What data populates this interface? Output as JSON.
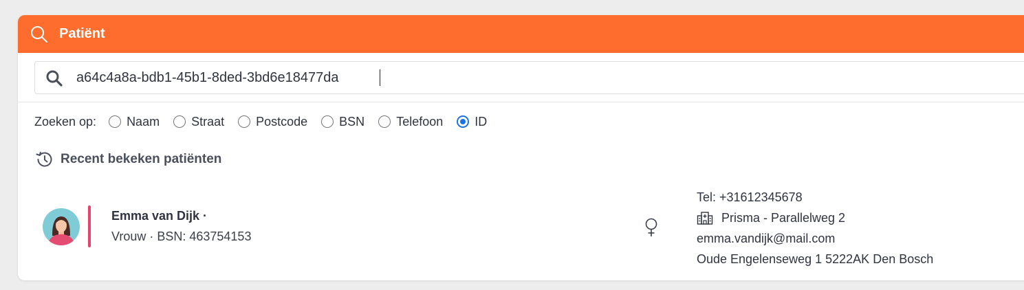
{
  "header": {
    "title": "Patiënt",
    "icon": "search-icon",
    "background_color": "#ff6d2e"
  },
  "search": {
    "value": "a64c4a8a-bdb1-45b1-8ded-3bd6e18477da",
    "icon": "search-icon"
  },
  "search_by": {
    "label": "Zoeken op:",
    "options": [
      {
        "label": "Naam",
        "checked": false
      },
      {
        "label": "Straat",
        "checked": false
      },
      {
        "label": "Postcode",
        "checked": false
      },
      {
        "label": "BSN",
        "checked": false
      },
      {
        "label": "Telefoon",
        "checked": false
      },
      {
        "label": "ID",
        "checked": true
      }
    ],
    "selected_color": "#1a73e8"
  },
  "recent": {
    "title": "Recent bekeken patiënten",
    "icon": "history-icon",
    "patients": [
      {
        "name": "Emma van Dijk ·",
        "subtitle": "Vrouw · BSN: 463754153",
        "gender_icon": "female-icon",
        "accent_color": "#e5456c",
        "phone": "Tel: +31612345678",
        "practice": "Prisma - Parallelweg 2",
        "practice_icon": "building-icon",
        "email": "emma.vandijk@mail.com",
        "address": "Oude Engelenseweg 1 5222AK Den Bosch"
      }
    ]
  }
}
